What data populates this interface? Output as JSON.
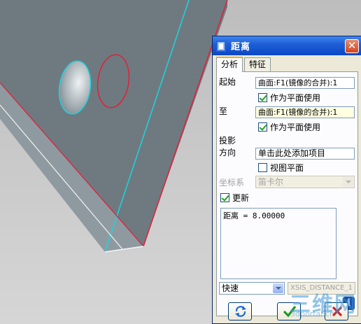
{
  "dialog": {
    "title": "距离",
    "close_symbol": "✕",
    "tabs": [
      {
        "label": "分析",
        "active": true
      },
      {
        "label": "特征",
        "active": false
      }
    ]
  },
  "analysis": {
    "from_label": "起始",
    "from_value": "曲面:F1(镜像的合并):1",
    "from_as_plane": {
      "label": "作为平面使用",
      "checked": true
    },
    "to_label": "至",
    "to_value": "曲面:F1(镜像的合并):1",
    "to_as_plane": {
      "label": "作为平面使用",
      "checked": true
    },
    "projection_label_1": "投影",
    "projection_label_2": "方向",
    "projection_value": "单击此处添加项目",
    "view_plane": {
      "label": "视图平面",
      "checked": false
    },
    "coord_sys_label": "坐标系",
    "coord_sys_value": "笛卡尔",
    "update": {
      "label": "更新",
      "checked": true
    },
    "result_text": "距离 = 8.00000",
    "mode_value": "快速",
    "param_value": "XSIS_DISTANCE_1"
  },
  "icons": {
    "info": "info-icon",
    "repeat": "repeat-icon",
    "ok": "checkmark-icon",
    "cancel": "cancel-icon"
  },
  "watermark": {
    "text": "三维网",
    "url": "3dportal.cn"
  }
}
